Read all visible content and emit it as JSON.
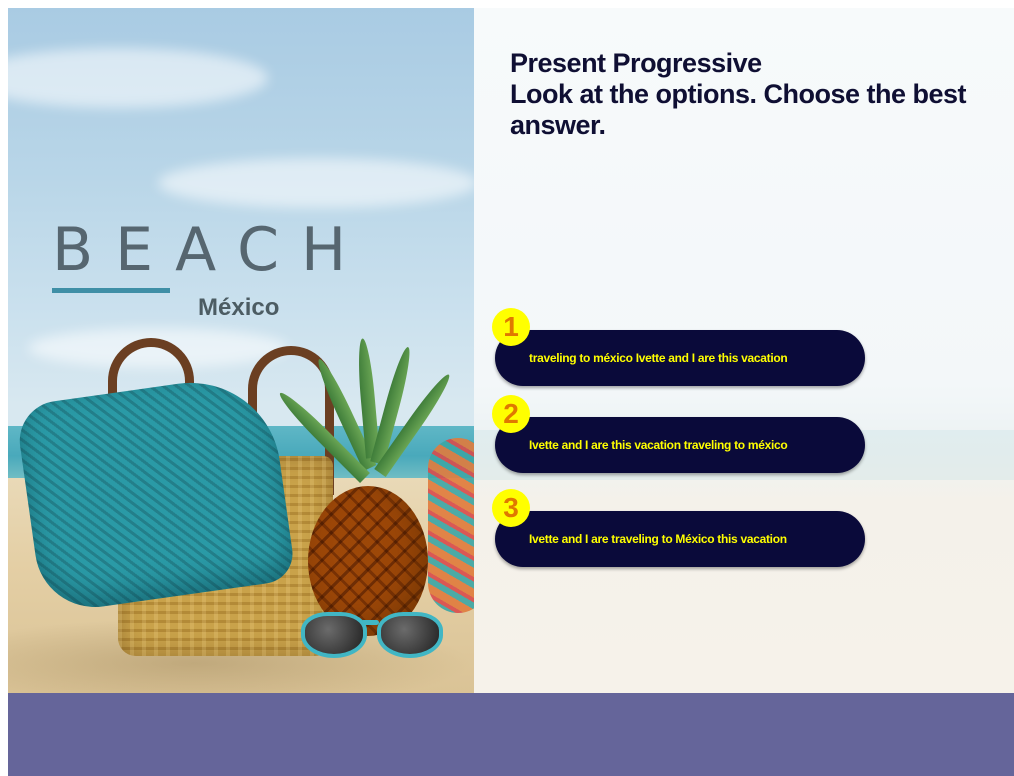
{
  "activity": {
    "title": "Present Progressive",
    "instruction": "Look at the options. Choose the best answer."
  },
  "brand": {
    "word": "BEACH",
    "subtitle": "México"
  },
  "options": [
    {
      "number": "1",
      "text": "traveling to méxico Ivette and I are this vacation"
    },
    {
      "number": "2",
      "text": "Ivette and I are this vacation traveling to méxico"
    },
    {
      "number": "3",
      "text": "Ivette and I are traveling to México this vacation"
    }
  ],
  "colors": {
    "option_background": "#0a0a3a",
    "option_text": "#ffff00",
    "badge_background": "#ffff00",
    "badge_number": "#e07800",
    "bottom_bar": "#65659a"
  }
}
